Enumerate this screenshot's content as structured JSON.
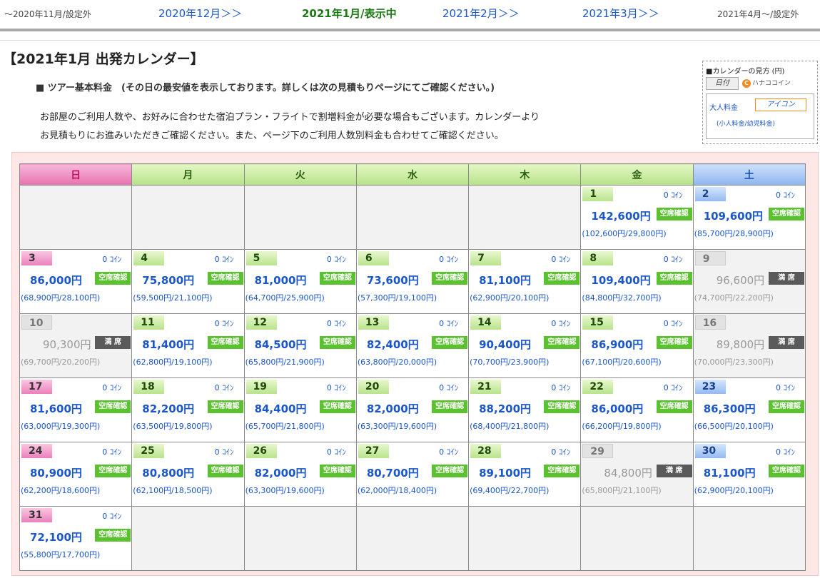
{
  "nav": {
    "prev_off": "～2020年11月/設定外",
    "prev2": "2020年12月＞＞",
    "current": "2021年1月/表示中",
    "next1": "2021年2月＞＞",
    "next2": "2021年3月＞＞",
    "next_off": "2021年4月～/設定外"
  },
  "page": {
    "title": "【2021年1月 出発カレンダー】",
    "subtitle": "■ ツアー基本料金　(その日の最安値を表示しております。詳しくは次の見積もりページにてご確認ください。)",
    "desc1": "お部屋のご利用人数や、お好みに合わせた宿泊プラン・フライトで割増料金が必要な場合もございます。カレンダーより",
    "desc2": "お見積もりにお進みいただきご確認ください。また、ページ下のご利用人数別料金も合わせてご確認ください。"
  },
  "legend": {
    "title": "■カレンダーの見方 (円)",
    "date": "日付",
    "coin_mark": "C",
    "coin": "ハナココイン",
    "adult": "大人料金",
    "icon": "アイコン",
    "child": "(小人料金/幼児料金)"
  },
  "calendar": {
    "weekdays": [
      "日",
      "月",
      "火",
      "水",
      "木",
      "金",
      "土"
    ],
    "status_ok": "空席確認",
    "status_full": "満 席",
    "coin_text": "0 ｺｲﾝ",
    "weeks": [
      [
        null,
        null,
        null,
        null,
        null,
        {
          "day": "1",
          "price": "142,600円",
          "sub": "(102,600円/29,800円)",
          "status": "ok"
        },
        {
          "day": "2",
          "price": "109,600円",
          "sub": "(85,700円/28,900円)",
          "status": "ok"
        }
      ],
      [
        {
          "day": "3",
          "price": "86,000円",
          "sub": "(68,900円/28,100円)",
          "status": "ok"
        },
        {
          "day": "4",
          "price": "75,800円",
          "sub": "(59,500円/21,100円)",
          "status": "ok"
        },
        {
          "day": "5",
          "price": "81,000円",
          "sub": "(64,700円/25,900円)",
          "status": "ok"
        },
        {
          "day": "6",
          "price": "73,600円",
          "sub": "(57,300円/19,100円)",
          "status": "ok"
        },
        {
          "day": "7",
          "price": "81,100円",
          "sub": "(62,900円/20,100円)",
          "status": "ok"
        },
        {
          "day": "8",
          "price": "109,400円",
          "sub": "(84,800円/32,700円)",
          "status": "ok"
        },
        {
          "day": "9",
          "price": "96,600円",
          "sub": "(74,700円/22,200円)",
          "status": "full"
        }
      ],
      [
        {
          "day": "10",
          "price": "90,300円",
          "sub": "(69,700円/20,200円)",
          "status": "full"
        },
        {
          "day": "11",
          "price": "81,400円",
          "sub": "(62,800円/19,100円)",
          "status": "ok"
        },
        {
          "day": "12",
          "price": "84,500円",
          "sub": "(65,800円/21,900円)",
          "status": "ok"
        },
        {
          "day": "13",
          "price": "82,400円",
          "sub": "(63,800円/20,000円)",
          "status": "ok"
        },
        {
          "day": "14",
          "price": "90,400円",
          "sub": "(70,700円/23,900円)",
          "status": "ok"
        },
        {
          "day": "15",
          "price": "86,900円",
          "sub": "(67,100円/20,600円)",
          "status": "ok"
        },
        {
          "day": "16",
          "price": "89,800円",
          "sub": "(70,000円/23,300円)",
          "status": "full"
        }
      ],
      [
        {
          "day": "17",
          "price": "81,600円",
          "sub": "(63,000円/19,300円)",
          "status": "ok"
        },
        {
          "day": "18",
          "price": "82,200円",
          "sub": "(63,500円/19,800円)",
          "status": "ok"
        },
        {
          "day": "19",
          "price": "84,400円",
          "sub": "(65,700円/21,800円)",
          "status": "ok"
        },
        {
          "day": "20",
          "price": "82,000円",
          "sub": "(63,300円/19,600円)",
          "status": "ok"
        },
        {
          "day": "21",
          "price": "88,200円",
          "sub": "(68,400円/21,800円)",
          "status": "ok"
        },
        {
          "day": "22",
          "price": "86,000円",
          "sub": "(66,200円/19,800円)",
          "status": "ok"
        },
        {
          "day": "23",
          "price": "86,300円",
          "sub": "(66,500円/20,100円)",
          "status": "ok"
        }
      ],
      [
        {
          "day": "24",
          "price": "80,900円",
          "sub": "(62,200円/18,600円)",
          "status": "ok"
        },
        {
          "day": "25",
          "price": "80,800円",
          "sub": "(62,100円/18,500円)",
          "status": "ok"
        },
        {
          "day": "26",
          "price": "82,000円",
          "sub": "(63,300円/19,600円)",
          "status": "ok"
        },
        {
          "day": "27",
          "price": "80,700円",
          "sub": "(62,000円/18,400円)",
          "status": "ok"
        },
        {
          "day": "28",
          "price": "89,100円",
          "sub": "(69,400円/22,700円)",
          "status": "ok"
        },
        {
          "day": "29",
          "price": "84,800円",
          "sub": "(65,800円/21,100円)",
          "status": "full"
        },
        {
          "day": "30",
          "price": "81,100円",
          "sub": "(62,900円/20,100円)",
          "status": "ok"
        }
      ],
      [
        {
          "day": "31",
          "price": "72,100円",
          "sub": "(55,800円/17,700円)",
          "status": "ok"
        },
        null,
        null,
        null,
        null,
        null,
        null
      ]
    ]
  }
}
